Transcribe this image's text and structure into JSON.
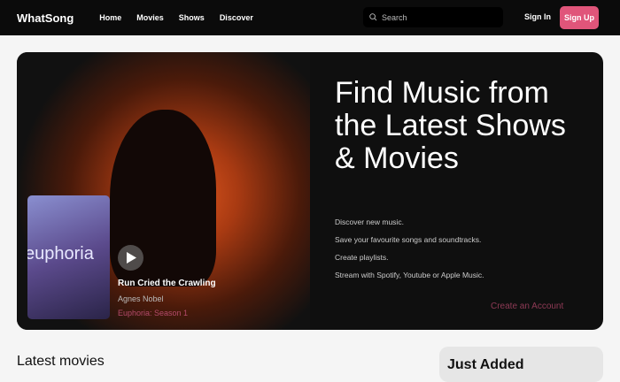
{
  "nav": {
    "logo": "WhatSong",
    "links": [
      "Home",
      "Movies",
      "Shows",
      "Discover"
    ],
    "search_placeholder": "Search",
    "sign_in": "Sign In",
    "sign_up": "Sign Up"
  },
  "hero": {
    "title": "Find Music from the Latest Shows & Movies",
    "features": [
      "Discover new music.",
      "Save your favourite songs and soundtracks.",
      "Create playlists.",
      "Stream with Spotify, Youtube or Apple Music."
    ],
    "cta": "Create an Account",
    "featured": {
      "poster_text": "euphoria",
      "song": "Run Cried the Crawling",
      "artist": "Agnes Nobel",
      "show": "Euphoria: Season 1"
    }
  },
  "sections": {
    "latest_movies": "Latest movies",
    "just_added": "Just Added"
  }
}
